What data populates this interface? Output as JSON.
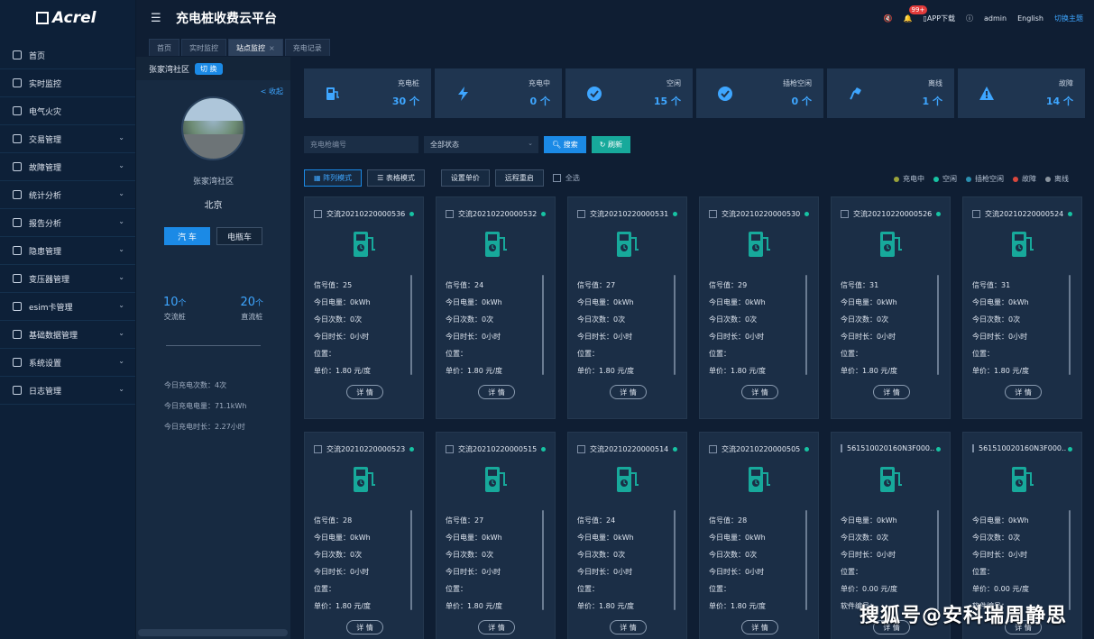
{
  "brand": {
    "logo": "Acrel"
  },
  "sidebar": {
    "items": [
      {
        "label": "首页",
        "chevron": false
      },
      {
        "label": "实时监控",
        "chevron": false
      },
      {
        "label": "电气火灾",
        "chevron": false
      },
      {
        "label": "交易管理",
        "chevron": true
      },
      {
        "label": "故障管理",
        "chevron": true
      },
      {
        "label": "统计分析",
        "chevron": true
      },
      {
        "label": "报告分析",
        "chevron": true
      },
      {
        "label": "隐患管理",
        "chevron": true
      },
      {
        "label": "变压器管理",
        "chevron": true
      },
      {
        "label": "esim卡管理",
        "chevron": true
      },
      {
        "label": "基础数据管理",
        "chevron": true
      },
      {
        "label": "系统设置",
        "chevron": true
      },
      {
        "label": "日志管理",
        "chevron": true
      }
    ]
  },
  "header": {
    "menu_icon": "menu-fold-icon",
    "title": "充电桩收费云平台",
    "bell_badge": "99+",
    "app_download": "APP下载",
    "user": "admin",
    "language": "English",
    "theme": "切换主题"
  },
  "tabs": [
    {
      "label": "首页",
      "active": false,
      "closable": false
    },
    {
      "label": "实时监控",
      "active": false,
      "closable": false
    },
    {
      "label": "站点监控",
      "active": true,
      "closable": true
    },
    {
      "label": "充电记录",
      "active": false,
      "closable": false
    }
  ],
  "site": {
    "name": "张家湾社区",
    "switch_label": "切 换",
    "collapse_label": "< 收起",
    "photo_name": "张家湾社区",
    "city": "北京",
    "vehicle_car": "汽 车",
    "vehicle_ebike": "电瓶车",
    "ac_count": "10",
    "ac_unit": "个",
    "ac_label": "交流桩",
    "dc_count": "20",
    "dc_unit": "个",
    "dc_label": "直流桩",
    "today_times": "今日充电次数：4次",
    "today_energy": "今日充电电量：71.1kWh",
    "today_duration": "今日充电时长：2.27小时"
  },
  "stats": [
    {
      "label": "充电桩",
      "value": "30 个",
      "icon": "charging-pile-icon"
    },
    {
      "label": "充电中",
      "value": "0 个",
      "icon": "lightning-icon"
    },
    {
      "label": "空闲",
      "value": "15 个",
      "icon": "check-circle-icon"
    },
    {
      "label": "插枪空闲",
      "value": "0 个",
      "icon": "check-circle-icon"
    },
    {
      "label": "离线",
      "value": "1 个",
      "icon": "plug-offline-icon"
    },
    {
      "label": "故障",
      "value": "14 个",
      "icon": "warning-icon"
    }
  ],
  "filter": {
    "gun_placeholder": "充电枪编号",
    "status_value": "全部状态",
    "search": "搜索",
    "refresh": "刷新"
  },
  "toolbar": {
    "array_mode": "阵列模式",
    "table_mode": "表格模式",
    "set_price": "设置单价",
    "remote_restart": "远程重启",
    "select_all": "全选"
  },
  "legend": [
    {
      "label": "充电中",
      "color": "#9aa33a"
    },
    {
      "label": "空闲",
      "color": "#17c3a3"
    },
    {
      "label": "插枪空闲",
      "color": "#2b8fb0"
    },
    {
      "label": "故障",
      "color": "#d9473d"
    },
    {
      "label": "离线",
      "color": "#8a949f"
    }
  ],
  "piles": [
    {
      "title": "交流20210220000536",
      "rows": [
        "信号值：25",
        "今日电量：0kWh",
        "今日次数：0次",
        "今日时长：0小时",
        "位置：",
        "单价：1.80 元/度"
      ]
    },
    {
      "title": "交流20210220000532",
      "rows": [
        "信号值：24",
        "今日电量：0kWh",
        "今日次数：0次",
        "今日时长：0小时",
        "位置：",
        "单价：1.80 元/度"
      ]
    },
    {
      "title": "交流20210220000531",
      "rows": [
        "信号值：27",
        "今日电量：0kWh",
        "今日次数：0次",
        "今日时长：0小时",
        "位置：",
        "单价：1.80 元/度"
      ]
    },
    {
      "title": "交流20210220000530",
      "rows": [
        "信号值：29",
        "今日电量：0kWh",
        "今日次数：0次",
        "今日时长：0小时",
        "位置：",
        "单价：1.80 元/度"
      ]
    },
    {
      "title": "交流20210220000526",
      "rows": [
        "信号值：31",
        "今日电量：0kWh",
        "今日次数：0次",
        "今日时长：0小时",
        "位置：",
        "单价：1.80 元/度"
      ]
    },
    {
      "title": "交流20210220000524",
      "rows": [
        "信号值：31",
        "今日电量：0kWh",
        "今日次数：0次",
        "今日时长：0小时",
        "位置：",
        "单价：1.80 元/度"
      ]
    },
    {
      "title": "交流20210220000523",
      "rows": [
        "信号值：28",
        "今日电量：0kWh",
        "今日次数：0次",
        "今日时长：0小时",
        "位置：",
        "单价：1.80 元/度"
      ]
    },
    {
      "title": "交流20210220000515",
      "rows": [
        "信号值：27",
        "今日电量：0kWh",
        "今日次数：0次",
        "今日时长：0小时",
        "位置：",
        "单价：1.80 元/度"
      ]
    },
    {
      "title": "交流20210220000514",
      "rows": [
        "信号值：24",
        "今日电量：0kWh",
        "今日次数：0次",
        "今日时长：0小时",
        "位置：",
        "单价：1.80 元/度"
      ]
    },
    {
      "title": "交流20210220000505",
      "rows": [
        "信号值：28",
        "今日电量：0kWh",
        "今日次数：0次",
        "今日时长：0小时",
        "位置：",
        "单价：1.80 元/度"
      ]
    },
    {
      "title": "561510020160N3F000...",
      "rows": [
        "今日电量：0kWh",
        "今日次数：0次",
        "今日时长：0小时",
        "位置：",
        "单价：0.00 元/度",
        "软件编号："
      ]
    },
    {
      "title": "561510020160N3F000...",
      "rows": [
        "今日电量：0kWh",
        "今日次数：0次",
        "今日时长：0小时",
        "位置：",
        "单价：0.00 元/度",
        "软件编号："
      ]
    }
  ],
  "detail_label": "详 情",
  "watermark": "搜狐号@安科瑞周静思"
}
